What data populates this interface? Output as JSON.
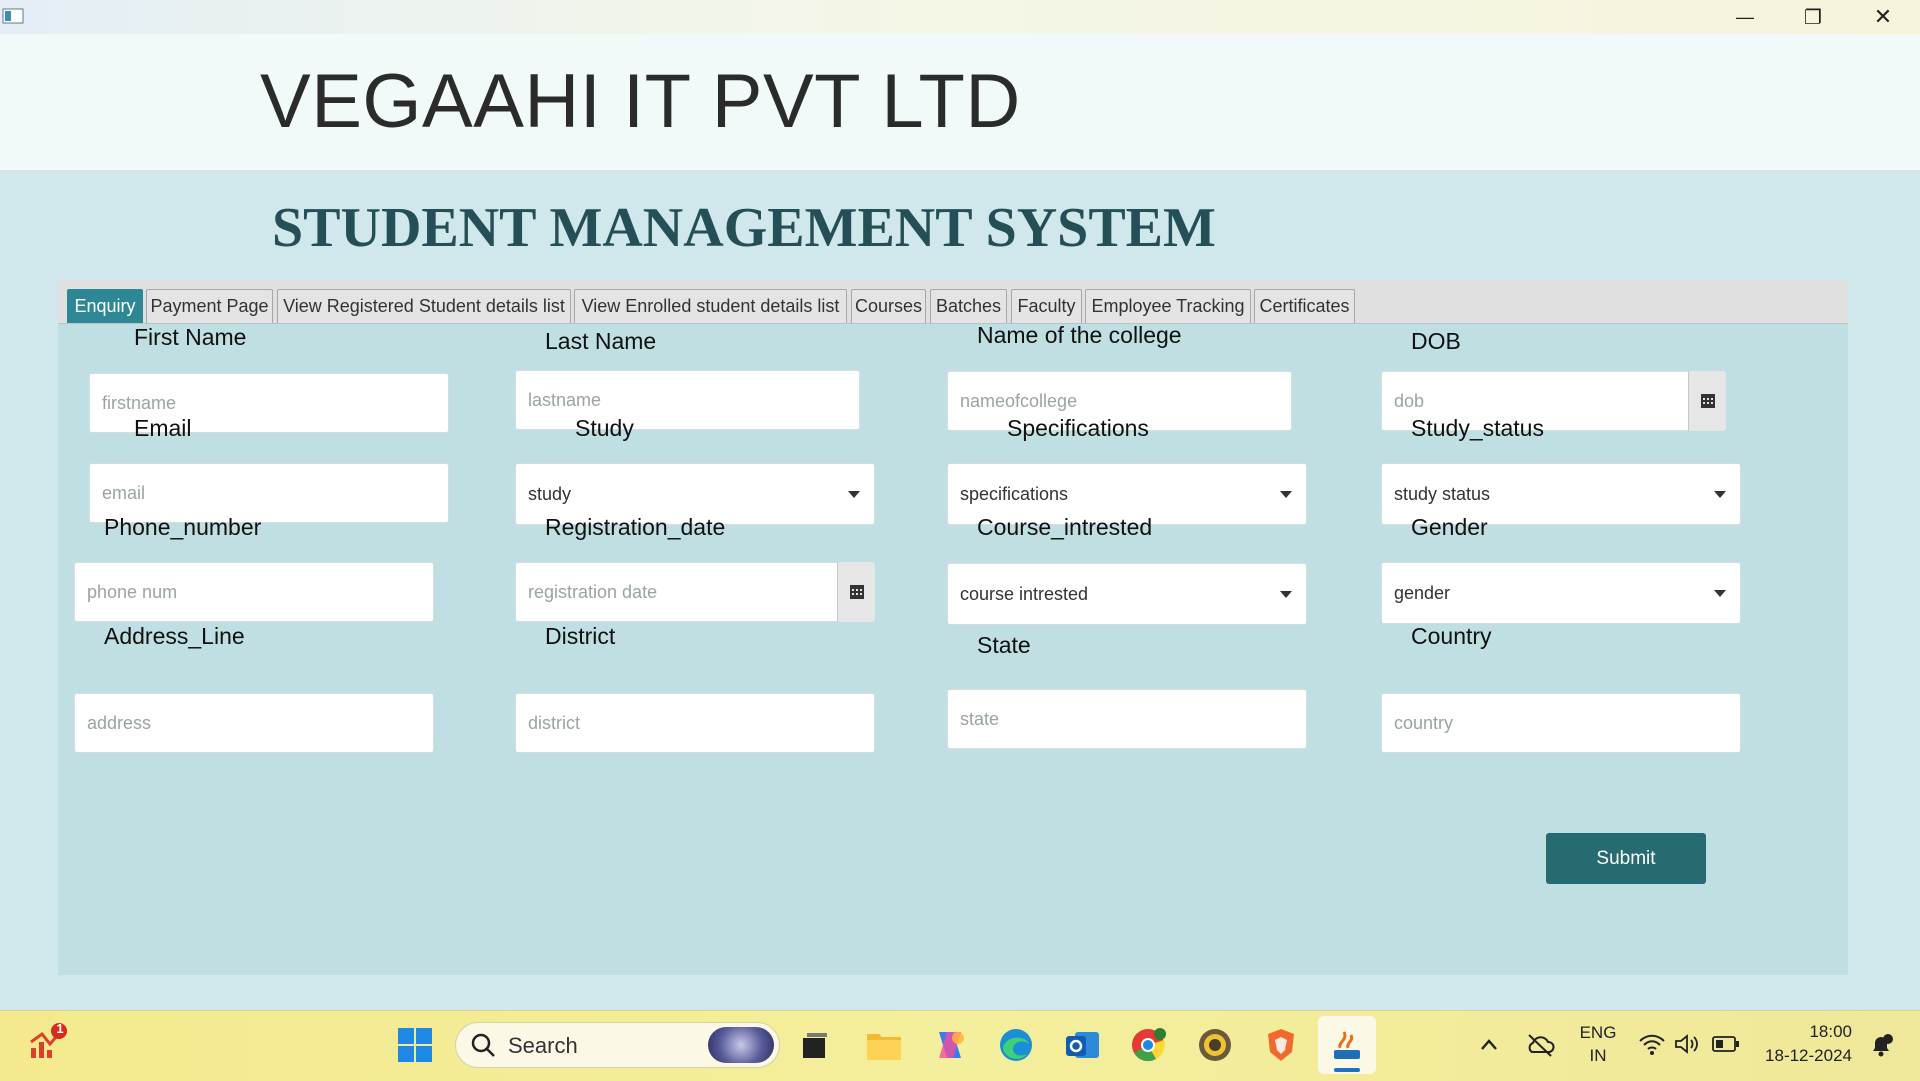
{
  "window": {
    "minimize_glyph": "—",
    "restore_glyph": "❐",
    "close_glyph": "✕"
  },
  "header": {
    "company": "VEGAAHI IT PVT LTD",
    "system_title": "STUDENT MANAGEMENT SYSTEM"
  },
  "tabs": [
    {
      "label": "Enquiry",
      "active": true
    },
    {
      "label": "Payment Page",
      "active": false
    },
    {
      "label": "View Registered Student details list",
      "active": false
    },
    {
      "label": "View Enrolled student details list",
      "active": false
    },
    {
      "label": "Courses",
      "active": false
    },
    {
      "label": "Batches",
      "active": false
    },
    {
      "label": "Faculty",
      "active": false
    },
    {
      "label": "Employee Tracking",
      "active": false
    },
    {
      "label": "Certificates",
      "active": false
    }
  ],
  "form": {
    "first_name": {
      "label": "First Name",
      "placeholder": "firstname"
    },
    "last_name": {
      "label": "Last Name",
      "placeholder": "lastname"
    },
    "college": {
      "label": "Name of the college",
      "placeholder": "nameofcollege"
    },
    "dob": {
      "label": "DOB",
      "placeholder": "dob"
    },
    "email": {
      "label": "Email",
      "placeholder": "email"
    },
    "study": {
      "label": "Study",
      "value": "study"
    },
    "specifications": {
      "label": "Specifications",
      "value": "specifications"
    },
    "study_status": {
      "label": "Study_status",
      "value": "study status"
    },
    "phone": {
      "label": "Phone_number",
      "placeholder": "phone num"
    },
    "registration_date": {
      "label": "Registration_date",
      "placeholder": "registration date"
    },
    "course_intrested": {
      "label": "Course_intrested",
      "value": "course intrested"
    },
    "gender": {
      "label": "Gender",
      "value": "gender"
    },
    "address": {
      "label": "Address_Line",
      "placeholder": "address"
    },
    "district": {
      "label": "District",
      "placeholder": "district"
    },
    "state": {
      "label": "State",
      "placeholder": "state"
    },
    "country": {
      "label": "Country",
      "placeholder": "country"
    },
    "submit_label": "Submit"
  },
  "taskbar": {
    "notification_badge": "1",
    "search_label": "Search",
    "language": "ENG",
    "region": "IN",
    "time": "18:00",
    "date": "18-12-2024"
  },
  "colors": {
    "accent": "#2e8794",
    "submit": "#256b70",
    "title": "#244f56"
  }
}
